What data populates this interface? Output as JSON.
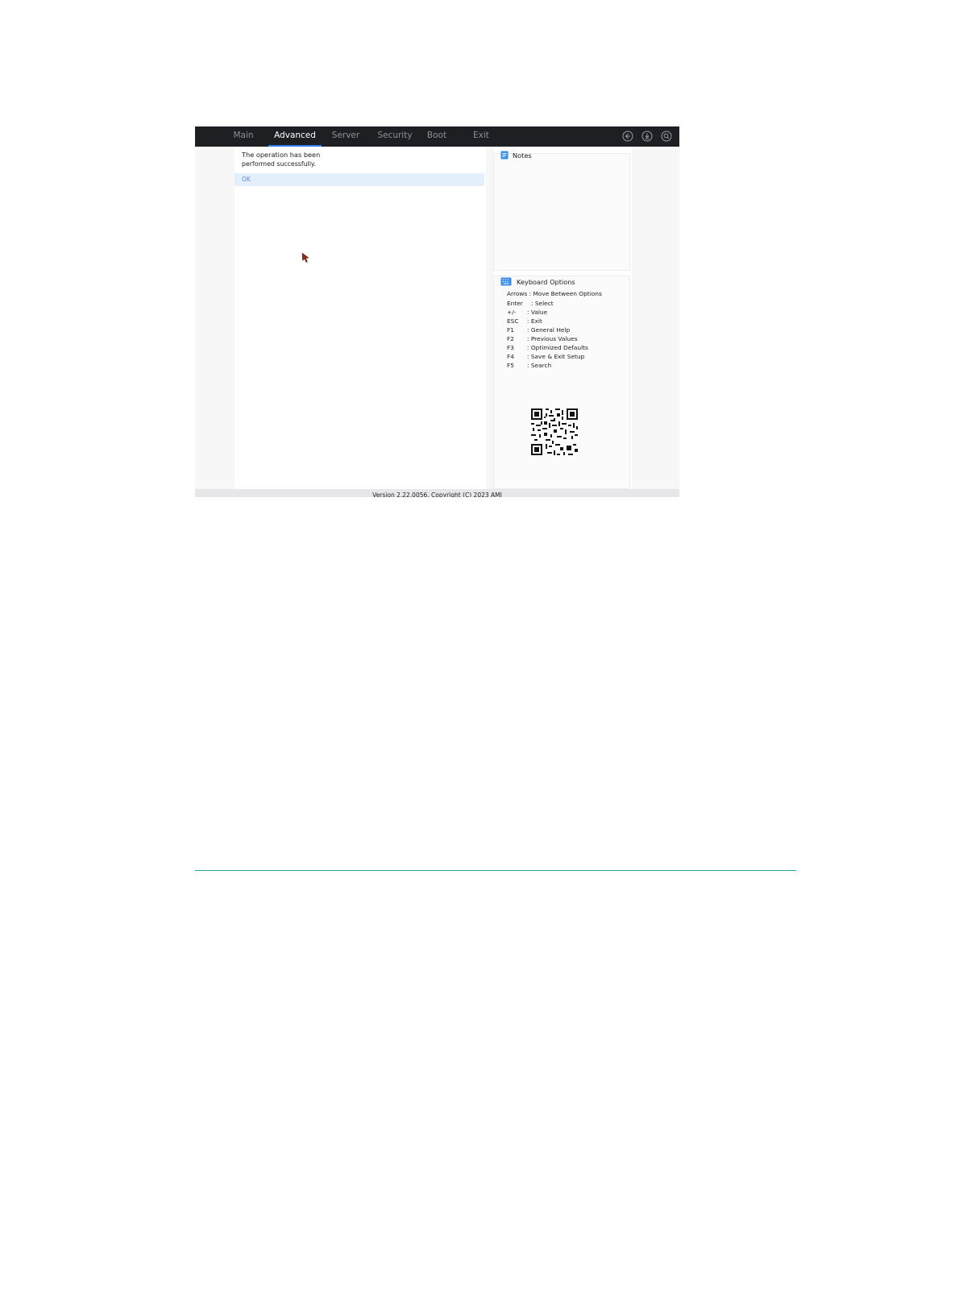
{
  "tabs": [
    {
      "label": "Main",
      "active": false
    },
    {
      "label": "Advanced",
      "active": true
    },
    {
      "label": "Server",
      "active": false
    },
    {
      "label": "Security",
      "active": false
    },
    {
      "label": "Boot",
      "active": false
    },
    {
      "label": "Exit",
      "active": false
    }
  ],
  "top_icons": [
    "back-icon",
    "download-icon",
    "search-icon"
  ],
  "dialog": {
    "line1": "The operation has been",
    "line2": "performed successfully.",
    "ok_label": "OK"
  },
  "notes": {
    "title": "Notes"
  },
  "keyboard": {
    "title": "Keyboard Options",
    "arrows": "Arrows : Move Between Options",
    "items": [
      {
        "key": "Enter",
        "desc": ": Select"
      },
      {
        "key": "+/-",
        "desc": ": Value"
      },
      {
        "key": "ESC",
        "desc": ": Exit"
      },
      {
        "key": "F1",
        "desc": ": General Help"
      },
      {
        "key": "F2",
        "desc": ": Previous Values"
      },
      {
        "key": "F3",
        "desc": ": Optimized Defaults"
      },
      {
        "key": "F4",
        "desc": ": Save & Exit Setup"
      },
      {
        "key": "F5",
        "desc": ": Search"
      }
    ]
  },
  "footer": "Version 2.22.0056. Copyright (C) 2023 AMI",
  "colors": {
    "accent": "#2f7df0",
    "topbar": "#1e1f23",
    "selection": "#e3effb",
    "rule": "#2aa39a"
  }
}
